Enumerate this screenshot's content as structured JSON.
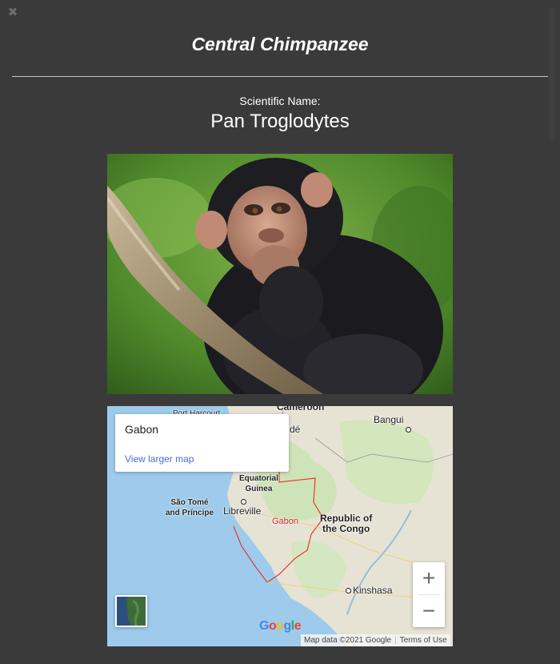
{
  "header": {
    "title": "Central Chimpanzee",
    "close_glyph": "✖"
  },
  "species": {
    "scientific_label": "Scientific Name:",
    "scientific_name": "Pan Troglodytes"
  },
  "photo": {
    "subject": "chimpanzee-photo"
  },
  "map": {
    "place_title": "Gabon",
    "view_larger_label": "View larger map",
    "labels": {
      "cameroon": "Cameroon",
      "port_harcourt": "Port Harcourt",
      "bangui": "Bangui",
      "yaounde_fragment": "dé",
      "equatorial_guinea": "Equatorial\nGuinea",
      "sao_tome": "São Tomé\nand Príncipe",
      "libreville": "Libreville",
      "gabon": "Gabon",
      "congo": "Republic of\nthe Congo",
      "kinshasa": "Kinshasa"
    },
    "zoom_in": "+",
    "zoom_out": "−",
    "logo": [
      "G",
      "o",
      "o",
      "g",
      "l",
      "e"
    ],
    "logo_colors": [
      "#4285f4",
      "#ea4335",
      "#fbbc05",
      "#4285f4",
      "#34a853",
      "#ea4335"
    ],
    "attribution": "Map data ©2021 Google",
    "terms": "Terms of Use"
  },
  "colors": {
    "background": "#3a3a3a",
    "text": "#ffffff",
    "link": "#4a6fd6",
    "border_red": "#e53935"
  }
}
